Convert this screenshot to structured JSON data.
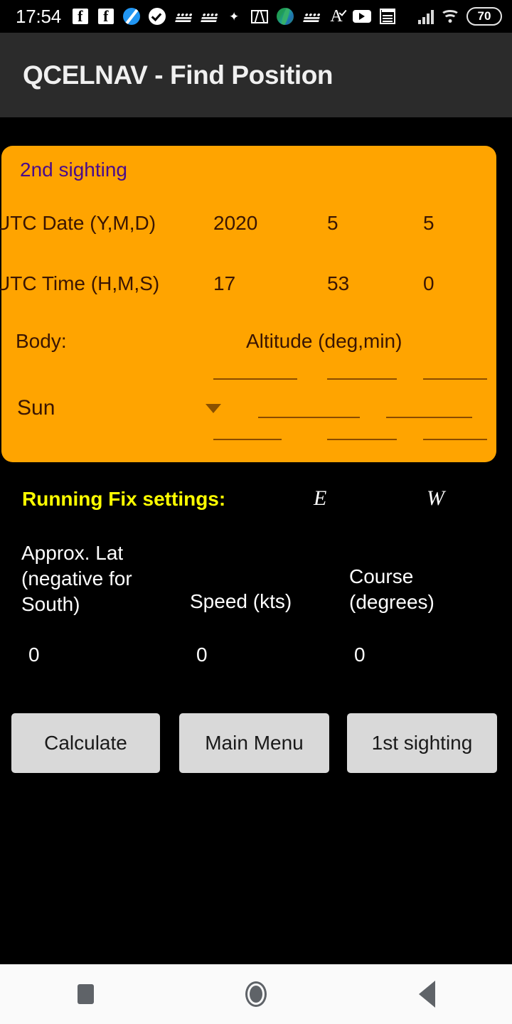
{
  "status_bar": {
    "clock": "17:54",
    "battery_level": "70",
    "left_icons": [
      "facebook-icon",
      "facebook-icon",
      "blue-circle-slash-icon",
      "check-circle-icon",
      "w-script-icon",
      "w-script-icon",
      "bird-icon",
      "gmail-icon",
      "leaf-icon",
      "w-script-icon",
      "a-check-icon",
      "youtube-icon",
      "notepad-icon"
    ],
    "right_icons": [
      "signal-bars-icon",
      "wifi-icon",
      "battery-icon"
    ]
  },
  "appbar": {
    "title": "QCELNAV - Find Position"
  },
  "sighting_card": {
    "title": "2nd sighting",
    "date_label": "UTC Date (Y,M,D)",
    "date": {
      "year": "2020",
      "month": "5",
      "day": "5"
    },
    "time_label": "UTC Time (H,M,S)",
    "time": {
      "hour": "17",
      "minute": "53",
      "second": "0"
    },
    "body_label": "Body:",
    "altitude_label": "Altitude (deg,min)",
    "body_value": "Sun",
    "body_options": [
      "Sun"
    ],
    "altitude_deg": "",
    "altitude_min": ""
  },
  "running_fix": {
    "title": "Running Fix settings:",
    "east_label": "E",
    "west_label": "W",
    "columns": [
      {
        "label": "Approx. Lat (negative for South)",
        "value": "0"
      },
      {
        "label": "Speed (kts)",
        "value": "0"
      },
      {
        "label": "Course (degrees)",
        "value": "0"
      }
    ]
  },
  "buttons": {
    "calculate": "Calculate",
    "main_menu": "Main Menu",
    "first_sighting": "1st sighting"
  },
  "nav_bar": {
    "recents": "recents-square-icon",
    "home": "home-circle-icon",
    "back": "back-triangle-icon"
  },
  "colors": {
    "card_background": "#FFA400",
    "card_title": "#4a0c8c",
    "accent_yellow": "#ffff00",
    "appbar_background": "#2b2b2b",
    "button_background": "#d9d9d9",
    "screen_background": "#000000"
  }
}
